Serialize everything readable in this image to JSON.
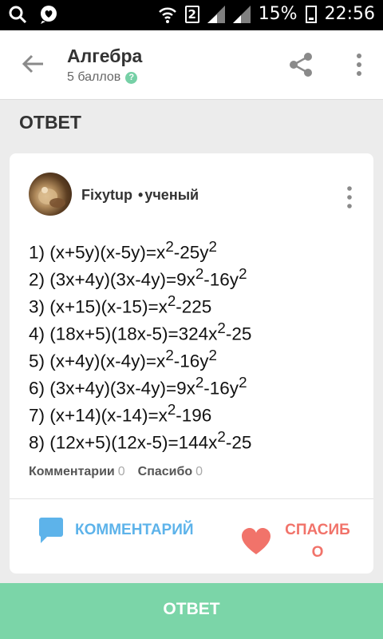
{
  "status_bar": {
    "sim": "2",
    "battery": "15%",
    "time": "22:56"
  },
  "header": {
    "title": "Алгебра",
    "points": "5 баллов",
    "help_glyph": "?"
  },
  "section": {
    "label": "ОТВЕТ"
  },
  "answer": {
    "author_name": "Fixytup",
    "author_separator": "•",
    "author_rank": "ученый",
    "lines": [
      {
        "num": "1)",
        "pre": "(x+5y)(x-5y)=x",
        "s1": "2",
        "mid": "-25y",
        "s2": "2",
        "post": ""
      },
      {
        "num": "2)",
        "pre": "(3x+4y)(3x-4y)=9x",
        "s1": "2",
        "mid": "-16y",
        "s2": "2",
        "post": ""
      },
      {
        "num": "3)",
        "pre": "(x+15)(x-15)=x",
        "s1": "2",
        "mid": "-225",
        "s2": "",
        "post": ""
      },
      {
        "num": "4)",
        "pre": "(18x+5)(18x-5)=324x",
        "s1": "2",
        "mid": "-25",
        "s2": "",
        "post": ""
      },
      {
        "num": "5)",
        "pre": "(x+4y)(x-4y)=x",
        "s1": "2",
        "mid": "-16y",
        "s2": "2",
        "post": ""
      },
      {
        "num": "6)",
        "pre": "(3x+4y)(3x-4y)=9x",
        "s1": "2",
        "mid": "-16y",
        "s2": "2",
        "post": ""
      },
      {
        "num": "7)",
        "pre": "(x+14)(x-14)=x",
        "s1": "2",
        "mid": "-196",
        "s2": "",
        "post": ""
      },
      {
        "num": "8)",
        "pre": "(12x+5)(12x-5)=144x",
        "s1": "2",
        "mid": "-25",
        "s2": "",
        "post": ""
      }
    ],
    "comments_label": "Комментарии",
    "comments_count": "0",
    "thanks_label": "Спасибо",
    "thanks_count": "0",
    "comment_button": "КОММЕНТАРИЙ",
    "thanks_button": "СПАСИБО"
  },
  "bottom_button": {
    "label": "ОТВЕТ"
  },
  "colors": {
    "accent_green": "#7bd5a8",
    "comment_blue": "#5db3ea",
    "thanks_red": "#f1736a"
  }
}
